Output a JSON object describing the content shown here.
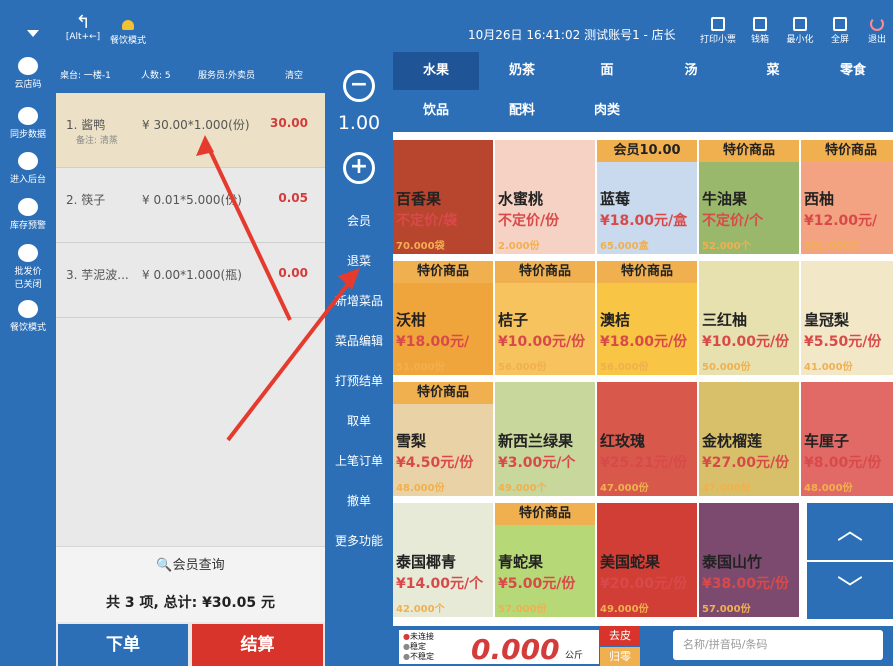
{
  "topbar": {
    "back_hint": "[Alt+←]",
    "mode_label": "餐饮模式",
    "datetime_user": "10月26日 16:41:02 测试账号1 - 店长",
    "actions": [
      "打印小票",
      "钱箱",
      "最小化",
      "全屏",
      "退出"
    ]
  },
  "sidebar": {
    "items": [
      "云店码",
      "同步数据",
      "进入后台",
      "库存预警",
      "批发价\n已关闭",
      "餐饮模式"
    ]
  },
  "order": {
    "header": {
      "table": "桌台: 一楼-1",
      "people": "人数: 5",
      "waiter": "服务员:外卖员",
      "clear": "清空"
    },
    "items": [
      {
        "name": "1. 酱鸭",
        "price": "¥ 30.00*1.000(份)",
        "total": "30.00",
        "note": "备注: 清蒸"
      },
      {
        "name": "2. 筷子",
        "price": "¥ 0.01*5.000(份)",
        "total": "0.05",
        "note": ""
      },
      {
        "name": "3. 芋泥波...",
        "price": "¥ 0.00*1.000(瓶)",
        "total": "0.00",
        "note": ""
      }
    ],
    "member_query": "会员查询",
    "summary": "共 3 项, 总计: ¥30.05 元",
    "submit": "下单",
    "checkout": "结算"
  },
  "ops": {
    "qty": "1.00",
    "items": [
      "会员",
      "退菜",
      "新增菜品",
      "菜品编辑",
      "打预结单",
      "取单",
      "上笔订单",
      "撤单",
      "更多功能"
    ]
  },
  "categories": {
    "row1": [
      "水果",
      "奶茶",
      "面",
      "汤",
      "菜",
      "零食"
    ],
    "row2": [
      "饮品",
      "配料",
      "肉类"
    ]
  },
  "products": [
    {
      "tag": "",
      "name": "百香果",
      "price": "不定价/袋",
      "stock": "70.000袋"
    },
    {
      "tag": "",
      "name": "水蜜桃",
      "price": "不定价/份",
      "stock": "2.000份"
    },
    {
      "tag": "会员10.00",
      "name": "蓝莓",
      "price": "¥18.00元/盒",
      "stock": "65.000盒"
    },
    {
      "tag": "特价商品",
      "name": "牛油果",
      "price": "不定价/个",
      "stock": "52.000个"
    },
    {
      "tag": "特价商品",
      "name": "西柚",
      "price": "¥12.00元/",
      "stock": "101.000克"
    },
    {
      "tag": "特价商品",
      "name": "沃柑",
      "price": "¥18.00元/",
      "stock": "51.000份"
    },
    {
      "tag": "特价商品",
      "name": "桔子",
      "price": "¥10.00元/份",
      "stock": "56.000份"
    },
    {
      "tag": "特价商品",
      "name": "澳桔",
      "price": "¥18.00元/份",
      "stock": "56.000份"
    },
    {
      "tag": "",
      "name": "三红柚",
      "price": "¥10.00元/份",
      "stock": "50.000份"
    },
    {
      "tag": "",
      "name": "皇冠梨",
      "price": "¥5.50元/份",
      "stock": "41.000份"
    },
    {
      "tag": "特价商品",
      "name": "雪梨",
      "price": "¥4.50元/份",
      "stock": "48.000份"
    },
    {
      "tag": "",
      "name": "新西兰绿果",
      "price": "¥3.00元/个",
      "stock": "49.000个"
    },
    {
      "tag": "",
      "name": "红玫瑰",
      "price": "¥25.21元/份",
      "stock": "47.000份"
    },
    {
      "tag": "",
      "name": "金枕榴莲",
      "price": "¥27.00元/份",
      "stock": "47.000份"
    },
    {
      "tag": "",
      "name": "车厘子",
      "price": "¥8.00元/份",
      "stock": "48.000份"
    },
    {
      "tag": "",
      "name": "泰国椰青",
      "price": "¥14.00元/个",
      "stock": "42.000个"
    },
    {
      "tag": "特价商品",
      "name": "青蛇果",
      "price": "¥5.00元/份",
      "stock": "57.000份"
    },
    {
      "tag": "",
      "name": "美国蛇果",
      "price": "¥20.00元/份",
      "stock": "49.000份"
    },
    {
      "tag": "",
      "name": "泰国山竹",
      "price": "¥38.00元/份",
      "stock": "57.000份"
    }
  ],
  "scale": {
    "status": [
      "未连接",
      "稳定",
      "不稳定"
    ],
    "weight": "0.000",
    "unit": "公斤",
    "tare": "去皮",
    "zero": "归零"
  },
  "search": {
    "placeholder": "名称/拼音码/条码"
  },
  "colors": {
    "blue": "#2d6fb7",
    "red": "#d9342b",
    "orange": "#f1b050"
  }
}
